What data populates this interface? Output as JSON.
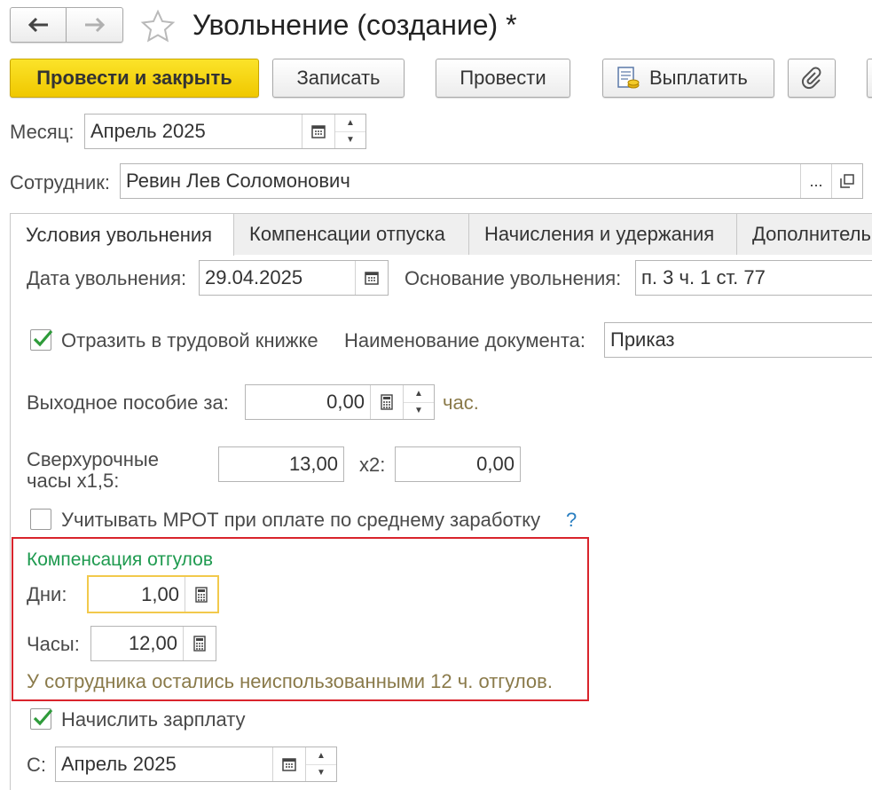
{
  "window": {
    "title": "Увольнение (создание) *",
    "back_icon": "arrow-left-icon",
    "forward_icon": "arrow-right-icon",
    "favorite_icon": "star-icon"
  },
  "toolbar": {
    "post_close": "Провести и закрыть",
    "save": "Записать",
    "post": "Провести",
    "pay": "Выплатить",
    "attach_icon": "paperclip-icon"
  },
  "header": {
    "month_label": "Месяц:",
    "month_value": "Апрель 2025",
    "employee_label": "Сотрудник:",
    "employee_value": "Ревин Лев Соломонович",
    "employee_select": "..."
  },
  "tabs": [
    {
      "label": "Условия увольнения",
      "active": true
    },
    {
      "label": "Компенсации отпуска",
      "active": false
    },
    {
      "label": "Начисления и удержания",
      "active": false
    },
    {
      "label": "Дополнитель",
      "active": false
    }
  ],
  "form": {
    "dismissal_date_label": "Дата увольнения:",
    "dismissal_date_value": "29.04.2025",
    "dismissal_reason_label": "Основание увольнения:",
    "dismissal_reason_value": "п. 3 ч. 1 ст. 77",
    "work_book_label": "Отразить в трудовой книжке",
    "work_book_checked": true,
    "doc_name_label": "Наименование документа:",
    "doc_name_value": "Приказ",
    "severance_label": "Выходное пособие за:",
    "severance_value": "0,00",
    "severance_unit": "час.",
    "overtime_label_line1": "Сверхурочные",
    "overtime_label_line2": "часы х1,5:",
    "overtime_value": "13,00",
    "overtime_x2_label": "х2:",
    "overtime_x2_value": "0,00",
    "mrot_label": "Учитывать МРОТ при оплате по среднему заработку",
    "mrot_checked": false,
    "help_mark": "?",
    "comp_title": "Компенсация отгулов",
    "days_label": "Дни:",
    "days_value": "1,00",
    "hours_label": "Часы:",
    "hours_value": "12,00",
    "comp_note": "У сотрудника остались неиспользованными 12 ч. отгулов.",
    "accrue_label": "Начислить зарплату",
    "accrue_checked": true,
    "from_label": "С:",
    "from_value": "Апрель 2025"
  },
  "colors": {
    "accent_yellow": "#f5d10f",
    "highlight_red": "#d9242c",
    "green_title": "#1e9a4f",
    "note_olive": "#8a7a4a",
    "check_green": "#2e9b3a"
  }
}
